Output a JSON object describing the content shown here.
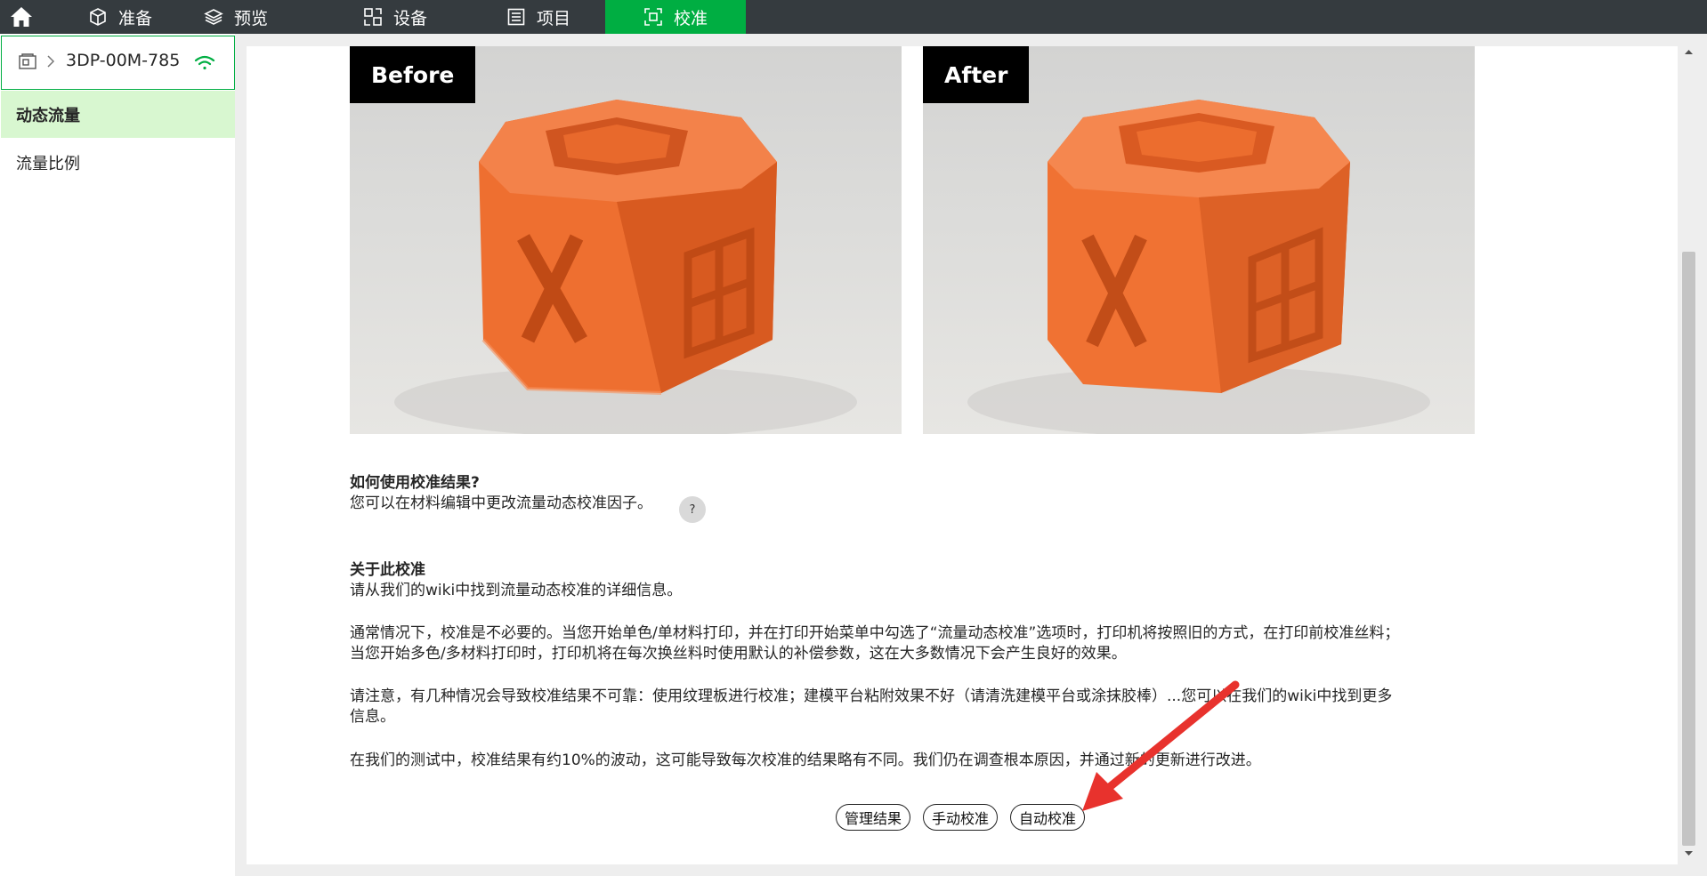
{
  "nav": {
    "home_icon": "home-icon",
    "tabs": [
      {
        "label": "准备",
        "icon": "cube-icon"
      },
      {
        "label": "预览",
        "icon": "layers-icon"
      },
      {
        "label": "设备",
        "icon": "device-icon"
      },
      {
        "label": "项目",
        "icon": "list-icon"
      },
      {
        "label": "校准",
        "icon": "calibrate-icon",
        "active": true
      }
    ]
  },
  "sidebar": {
    "device_name": "3DP-00M-785",
    "items": [
      {
        "label": "动态流量",
        "active": true
      },
      {
        "label": "流量比例",
        "active": false
      }
    ]
  },
  "content": {
    "before_label": "Before",
    "after_label": "After",
    "usage_heading": "如何使用校准结果?",
    "usage_text": "您可以在材料编辑中更改流量动态校准因子。",
    "help_badge": "?",
    "about_heading": "关于此校准",
    "about_intro": "请从我们的wiki中找到流量动态校准的详细信息。",
    "para1_line1": "通常情况下，校准是不必要的。当您开始单色/单材料打印，并在打印开始菜单中勾选了“流量动态校准”选项时，打印机将按照旧的方式，在打印前校准丝料；",
    "para1_line2": "当您开始多色/多材料打印时，打印机将在每次换丝料时使用默认的补偿参数，这在大多数情况下会产生良好的效果。",
    "para2_line1": "请注意，有几种情况会导致校准结果不可靠：使用纹理板进行校准；建模平台粘附效果不好（请清洗建模平台或涂抹胶棒）...您可以在我们的wiki中找到更多",
    "para2_line2": "信息。",
    "para3": "在我们的测试中，校准结果有约10%的波动，这可能导致每次校准的结果略有不同。我们仍在调查根本原因，并通过新的更新进行改进。"
  },
  "buttons": {
    "manage": "管理结果",
    "manual": "手动校准",
    "auto": "自动校准"
  },
  "colors": {
    "accent": "#00ae42",
    "topbar": "#353b3f",
    "sidebar_active": "#d8f7d0",
    "cube_orange": "#f07233",
    "annotation_arrow": "#e8322d"
  }
}
